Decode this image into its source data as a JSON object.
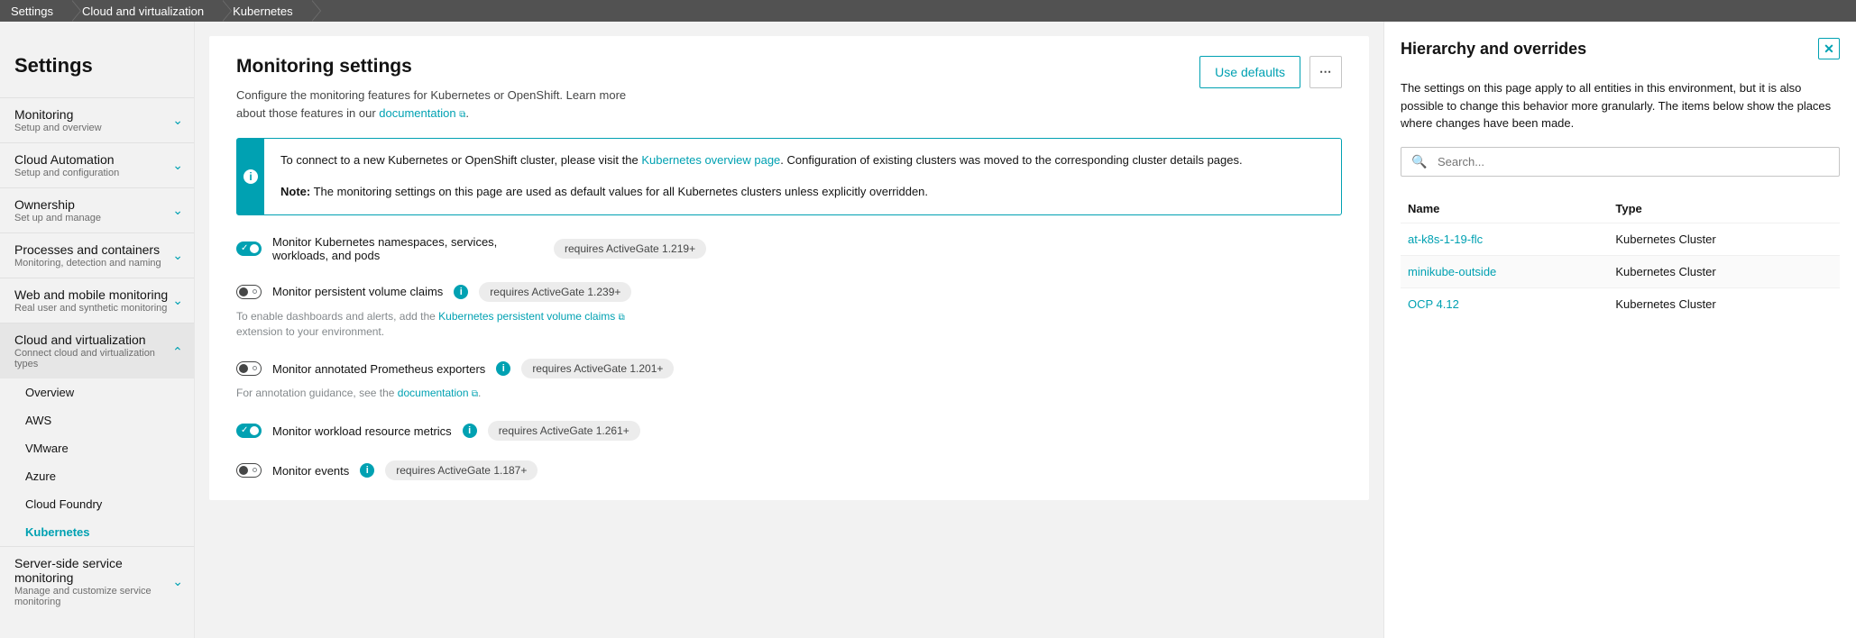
{
  "breadcrumb": [
    "Settings",
    "Cloud and virtualization",
    "Kubernetes"
  ],
  "sidebar": {
    "title": "Settings",
    "groups": [
      {
        "title": "Monitoring",
        "sub": "Setup and overview"
      },
      {
        "title": "Cloud Automation",
        "sub": "Setup and configuration"
      },
      {
        "title": "Ownership",
        "sub": "Set up and manage"
      },
      {
        "title": "Processes and containers",
        "sub": "Monitoring, detection and naming"
      },
      {
        "title": "Web and mobile monitoring",
        "sub": "Real user and synthetic monitoring"
      },
      {
        "title": "Cloud and virtualization",
        "sub": "Connect cloud and virtualization types",
        "expanded": true,
        "items": [
          "Overview",
          "AWS",
          "VMware",
          "Azure",
          "Cloud Foundry",
          "Kubernetes"
        ],
        "selected": "Kubernetes"
      },
      {
        "title": "Server-side service monitoring",
        "sub": "Manage and customize service monitoring"
      }
    ]
  },
  "main": {
    "heading": "Monitoring settings",
    "desc_pre": "Configure the monitoring features for Kubernetes or OpenShift. Learn more about those features in our ",
    "doc_link": "documentation",
    "use_defaults": "Use defaults",
    "info": {
      "p1_pre": "To connect to a new Kubernetes or OpenShift cluster, please visit the ",
      "p1_link": "Kubernetes overview page",
      "p1_post": ". Configuration of existing clusters was moved to the corresponding cluster details pages.",
      "p2_bold": "Note:",
      "p2_rest": " The monitoring settings on this page are used as default values for all Kubernetes clusters unless explicitly overridden."
    },
    "rows": [
      {
        "on": true,
        "label": "Monitor Kubernetes namespaces, services, workloads, and pods",
        "info": false,
        "pill": "requires ActiveGate 1.219+"
      },
      {
        "on": false,
        "label": "Monitor persistent volume claims",
        "info": true,
        "pill": "requires ActiveGate 1.239+",
        "hint_pre": "To enable dashboards and alerts, add the ",
        "hint_link": "Kubernetes persistent volume claims",
        "hint_post": " extension to your environment."
      },
      {
        "on": false,
        "label": "Monitor annotated Prometheus exporters",
        "info": true,
        "pill": "requires ActiveGate 1.201+",
        "hint_pre": "For annotation guidance, see the ",
        "hint_link": "documentation",
        "hint_post": "."
      },
      {
        "on": true,
        "label": "Monitor workload resource metrics",
        "info": true,
        "pill": "requires ActiveGate 1.261+"
      },
      {
        "on": false,
        "label": "Monitor events",
        "info": true,
        "pill": "requires ActiveGate 1.187+"
      }
    ]
  },
  "right": {
    "title": "Hierarchy and overrides",
    "desc": "The settings on this page apply to all entities in this environment, but it is also possible to change this behavior more granularly. The items below show the places where changes have been made.",
    "search_ph": "Search...",
    "cols": {
      "name": "Name",
      "type": "Type"
    },
    "rows": [
      {
        "name": "at-k8s-1-19-flc",
        "type": "Kubernetes Cluster"
      },
      {
        "name": "minikube-outside",
        "type": "Kubernetes Cluster"
      },
      {
        "name": "OCP 4.12",
        "type": "Kubernetes Cluster"
      }
    ]
  }
}
